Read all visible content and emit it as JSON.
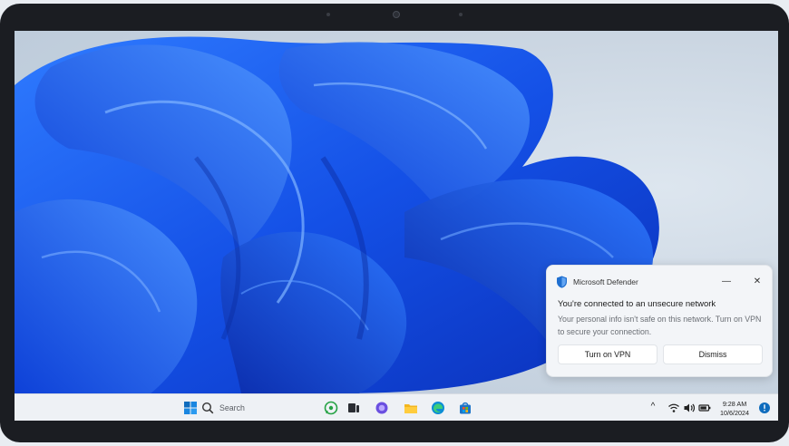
{
  "notification": {
    "app_name": "Microsoft Defender",
    "title": "You're connected to an unsecure network",
    "body": "Your personal info isn't safe on this network. Turn on VPN to secure your connection.",
    "primary_button": "Turn on VPN",
    "secondary_button": "Dismiss",
    "minimize_glyph": "—",
    "close_glyph": "✕"
  },
  "taskbar": {
    "search_placeholder": "Search",
    "apps": [
      "start-icon",
      "search-icon",
      "whatsapp-icon",
      "task-view-icon",
      "copilot-icon",
      "file-explorer-icon",
      "edge-icon",
      "store-icon"
    ],
    "tray": {
      "overflow_glyph": "^",
      "time": "9:28 AM",
      "date": "10/6/2024"
    }
  },
  "colors": {
    "accent": "#0f6cbd",
    "wallpaper_blue": "#1e63f0",
    "taskbar": "#eef1f5"
  }
}
